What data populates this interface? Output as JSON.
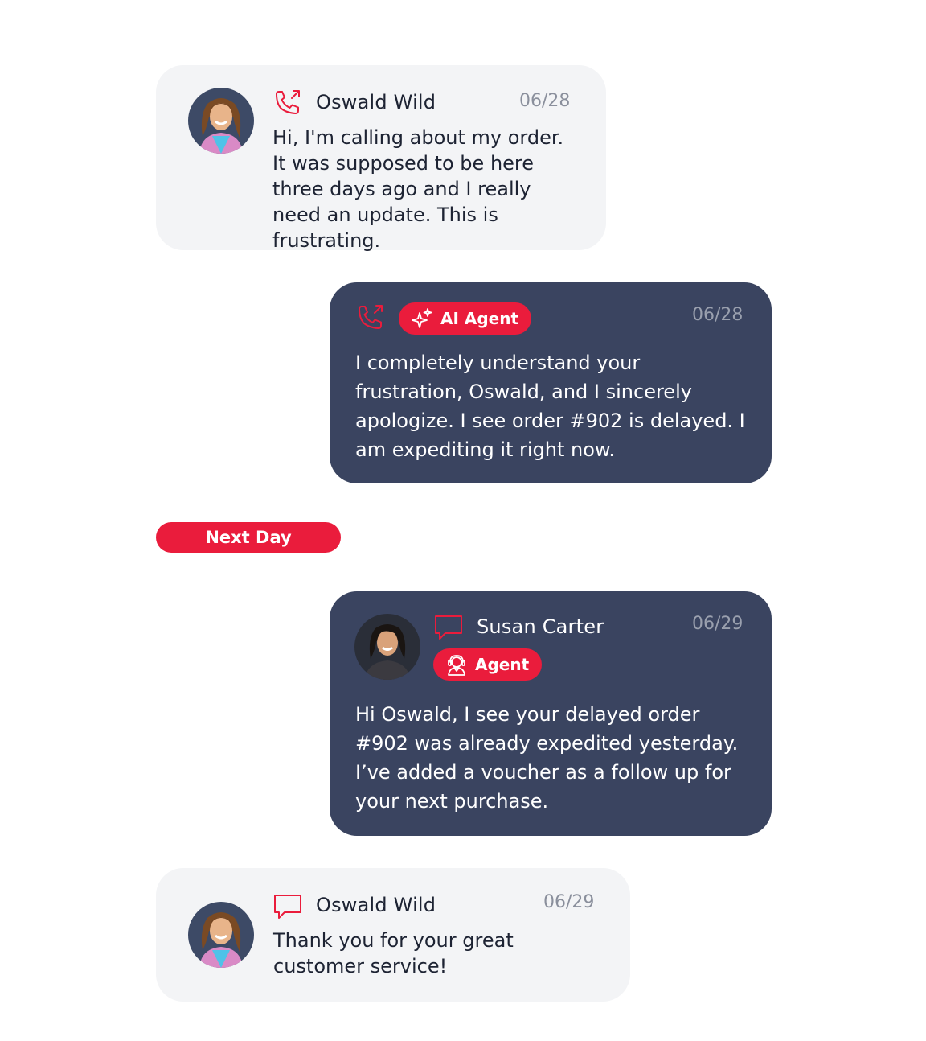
{
  "colors": {
    "accent": "#ea1c3c",
    "dark_card": "#3a4460",
    "light_card": "#f3f4f6",
    "date": "#8a8f9c"
  },
  "messages": [
    {
      "sender": "Oswald Wild",
      "date": "06/28",
      "channel_icon": "phone-outgoing-icon",
      "text": "Hi, I'm calling about my order. It was supposed to be here three days ago and I really need an update. This is frustrating."
    },
    {
      "badge": "AI Agent",
      "badge_icon": "sparkle-icon",
      "date": "06/28",
      "channel_icon": "phone-outgoing-icon",
      "text": "I completely understand your frustration, Oswald, and I sincerely apologize. I see order #902 is delayed. I am expediting it right now."
    },
    {
      "sender": "Susan Carter",
      "badge": "Agent",
      "badge_icon": "headset-agent-icon",
      "date": "06/29",
      "channel_icon": "chat-bubble-icon",
      "text": "Hi Oswald, I see your delayed order #902 was already expedited yesterday. I’ve added a voucher as a follow up for your next purchase."
    },
    {
      "sender": "Oswald Wild",
      "date": "06/29",
      "channel_icon": "chat-bubble-icon",
      "text": "Thank you for your great customer service!"
    }
  ],
  "divider": {
    "label": "Next Day"
  }
}
